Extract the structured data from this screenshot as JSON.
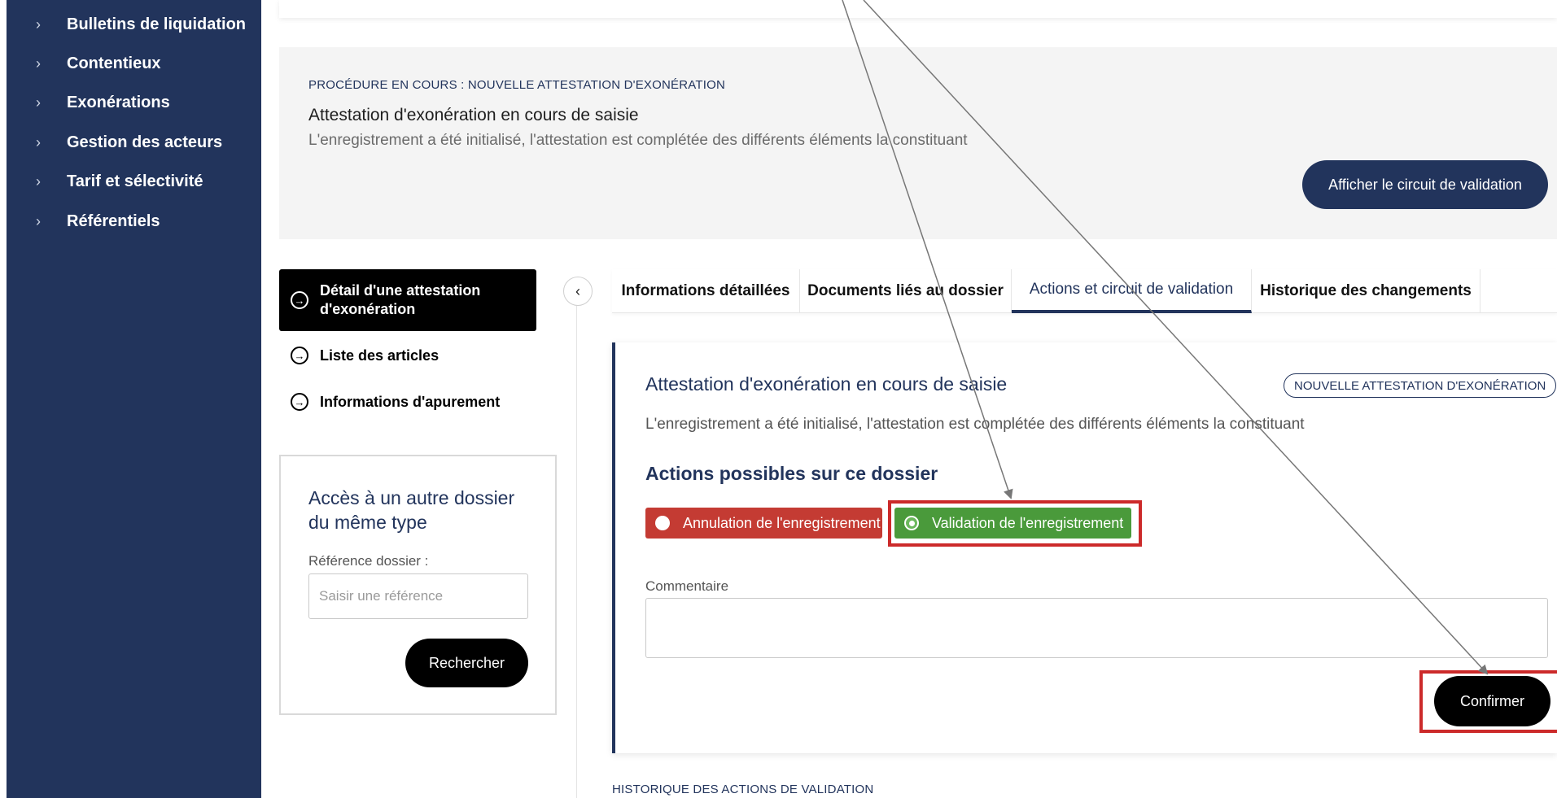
{
  "sidebar": {
    "items": [
      {
        "label": "Bulletins de liquidation"
      },
      {
        "label": "Contentieux"
      },
      {
        "label": "Exonérations"
      },
      {
        "label": "Gestion des acteurs"
      },
      {
        "label": "Tarif et sélectivité"
      },
      {
        "label": "Référentiels"
      }
    ]
  },
  "procedure": {
    "kicker": "PROCÉDURE EN COURS : NOUVELLE ATTESTATION D'EXONÉRATION",
    "title": "Attestation d'exonération en cours de saisie",
    "description": "L'enregistrement a été initialisé, l'attestation est complétée des différents éléments la constituant",
    "circuit_button": "Afficher le circuit de validation"
  },
  "left_nav": {
    "active": "Détail d'une attestation d'exonération",
    "items": [
      {
        "label": "Liste des articles"
      },
      {
        "label": "Informations d'apurement"
      }
    ]
  },
  "other_dossier": {
    "title": "Accès à un autre dossier du même type",
    "ref_label": "Référence dossier :",
    "ref_placeholder": "Saisir une référence",
    "search_button": "Rechercher"
  },
  "tabs": [
    {
      "label": "Informations détaillées"
    },
    {
      "label": "Documents liés au dossier"
    },
    {
      "label": "Actions et circuit de validation",
      "active": true
    },
    {
      "label": "Historique des changements"
    }
  ],
  "card": {
    "title": "Attestation d'exonération en cours de saisie",
    "badge": "NOUVELLE ATTESTATION D'EXONÉRATION",
    "description": "L'enregistrement a été initialisé, l'attestation est complétée des différents éléments la constituant",
    "actions_title": "Actions possibles sur ce dossier",
    "action_cancel": "Annulation de l'enregistrement",
    "action_validate": "Validation de l'enregistrement",
    "selected_action": "Validation de l'enregistrement",
    "comment_label": "Commentaire",
    "comment_value": "",
    "confirm_button": "Confirmer"
  },
  "history_title": "HISTORIQUE DES ACTIONS DE VALIDATION",
  "colors": {
    "navy": "#22345c",
    "danger": "#c43b33",
    "success": "#4a9a3b",
    "highlight": "#cc2a2a"
  },
  "icons": {
    "sidebar_chevron": "chevron-right-icon",
    "nav_arrow": "circle-arrow-right-icon",
    "collapse": "chevron-left-icon"
  }
}
